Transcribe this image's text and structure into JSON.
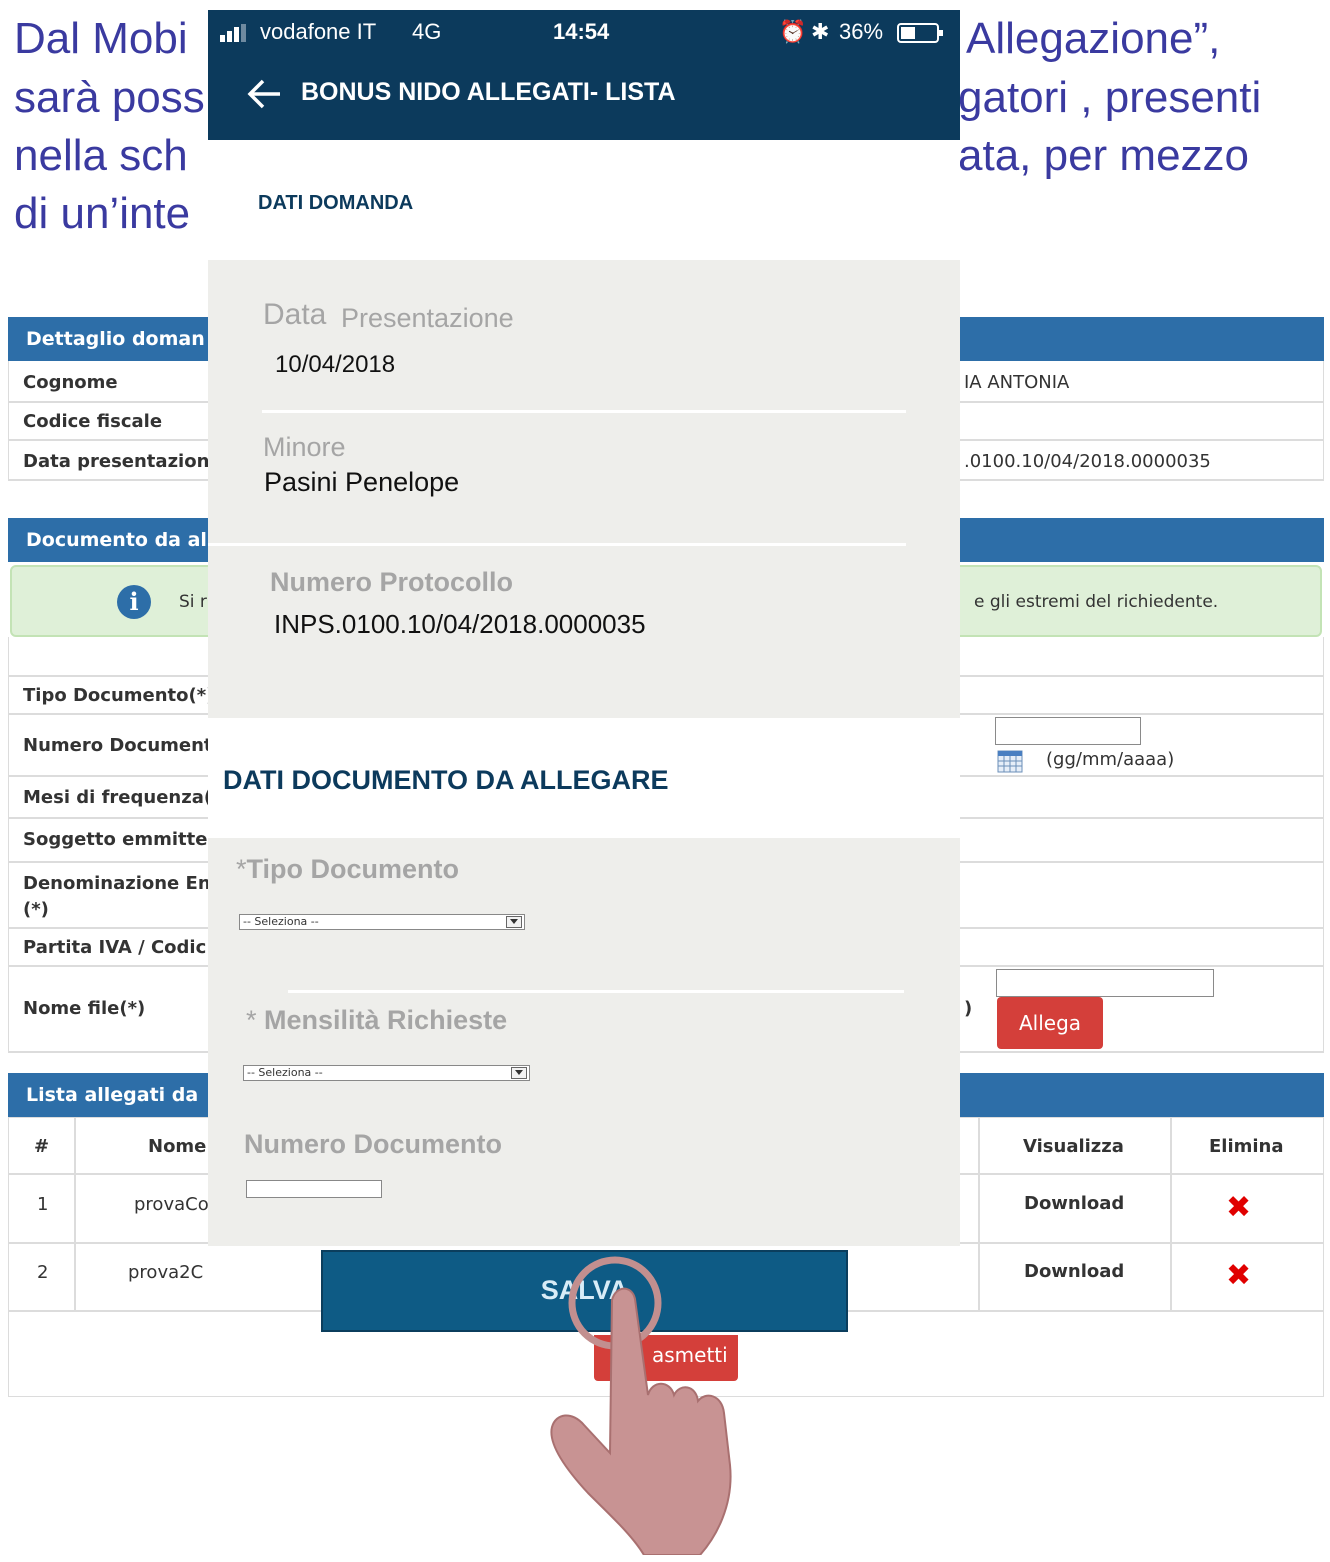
{
  "slide": {
    "line1_left": "Dal Mobi",
    "line1_right": "Allegazione”,",
    "line2_left": "sarà poss",
    "line2_right": "gatori , presenti",
    "line3_left": "nella sch",
    "line3_right": "ata, per mezzo",
    "line4_left": "di un’inte"
  },
  "desktop": {
    "detail_panel_title": "Dettaglio doman",
    "cognome_label": "Cognome",
    "cognome_value": "IA ANTONIA",
    "codice_fiscale_label": "Codice fiscale",
    "data_presentazione_label": "Data presentazione",
    "protocol_value": ".0100.10/04/2018.0000035",
    "document_panel_title": "Documento da al",
    "info_text_left": "Si r",
    "info_text_right": "e gli estremi del richiedente.",
    "tipo_documento_label": "Tipo Documento(*)",
    "numero_documento_label": "Numero Document",
    "date_hint": "(gg/mm/aaaa)",
    "mesi_label": "Mesi di frequenza(*",
    "soggetto_label": "Soggetto emmitten",
    "denominazione_label_1": "Denominazione Ent",
    "denominazione_label_2": "(*)",
    "partita_iva_label": "Partita IVA / Codic",
    "nome_file_label": "Nome file(*)",
    "nome_file_paren": ")",
    "allega_button": "Allega",
    "list_panel_title": "Lista allegati da",
    "table_headers": {
      "num": "#",
      "nome": "Nome",
      "visualizza": "Visualizza",
      "elimina": "Elimina"
    },
    "table_rows": [
      {
        "num": "1",
        "nome": "provaCo",
        "visualizza": "Download"
      },
      {
        "num": "2",
        "nome": "prova2C",
        "visualizza": "Download"
      }
    ],
    "trasmetti_button": "asmetti"
  },
  "phone": {
    "carrier": "vodafone IT",
    "network": "4G",
    "time": "14:54",
    "battery": "36%",
    "appbar_title": "BONUS NIDO ALLEGATI- LISTA",
    "section1_title": "DATI DOMANDA",
    "data_presentazione_label_a": "Data",
    "data_presentazione_label_b": "Presentazione",
    "data_presentazione_value": "10/04/2018",
    "minore_label": "Minore",
    "minore_value": "Pasini Penelope",
    "protocollo_label": "Numero Protocollo",
    "protocollo_value": "INPS.0100.10/04/2018.0000035",
    "section2_title": "DATI DOCUMENTO DA ALLEGARE",
    "tipo_documento_label": "Tipo Documento",
    "tipo_documento_select": "-- Seleziona --",
    "mensilita_label": "Mensilità Richieste",
    "mensilita_select": "-- Seleziona --",
    "numero_documento_label": "Numero Documento",
    "required_mark": "*",
    "save_button": "SALVA"
  },
  "colors": {
    "phone_header": "#0c3a5c",
    "panel_header": "#2d6ea8",
    "save_button": "#0e5b85",
    "danger": "#d43f3a",
    "slide_text": "#3a3aa0"
  }
}
